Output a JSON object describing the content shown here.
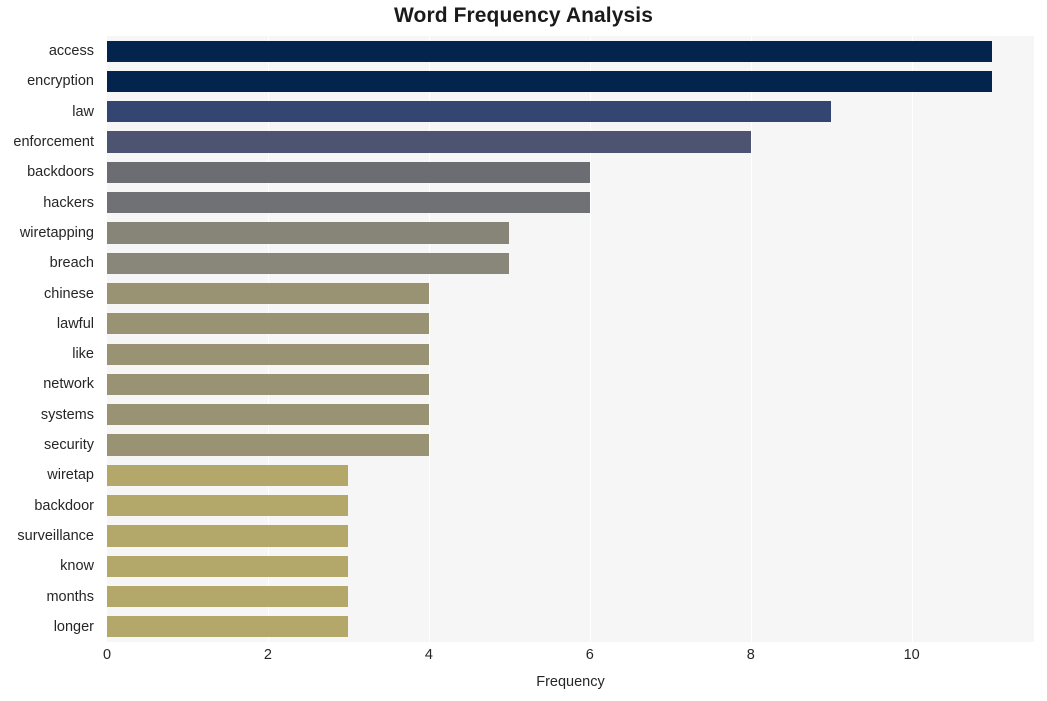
{
  "chart_data": {
    "type": "bar",
    "orientation": "horizontal",
    "title": "Word Frequency Analysis",
    "xlabel": "Frequency",
    "ylabel": "",
    "categories": [
      "access",
      "encryption",
      "law",
      "enforcement",
      "backdoors",
      "hackers",
      "wiretapping",
      "breach",
      "chinese",
      "lawful",
      "like",
      "network",
      "systems",
      "security",
      "wiretap",
      "backdoor",
      "surveillance",
      "know",
      "months",
      "longer"
    ],
    "values": [
      11,
      11,
      9,
      8,
      6,
      6,
      5,
      5,
      4,
      4,
      4,
      4,
      4,
      4,
      3,
      3,
      3,
      3,
      3,
      3
    ],
    "bar_colors": [
      "#03244d",
      "#03244d",
      "#334570",
      "#4d5471",
      "#6b6d72",
      "#6f7175",
      "#868578",
      "#888779",
      "#9a9373",
      "#9a9373",
      "#9a9373",
      "#9a9373",
      "#9a9373",
      "#9a9373",
      "#b3a76a",
      "#b3a76a",
      "#b3a76a",
      "#b3a76a",
      "#b3a76a",
      "#b3a76a"
    ],
    "xlim": [
      0,
      11.52
    ],
    "xticks": [
      0,
      2,
      4,
      6,
      8,
      10
    ],
    "xticklabels": [
      "0",
      "2",
      "4",
      "6",
      "8",
      "10"
    ],
    "grid": true,
    "grid_axis": "x",
    "grid_color": "#ffffff",
    "legend": false,
    "plot_background": "#f6f6f6",
    "figure_background": "#ffffff",
    "text_color": "#262626"
  }
}
